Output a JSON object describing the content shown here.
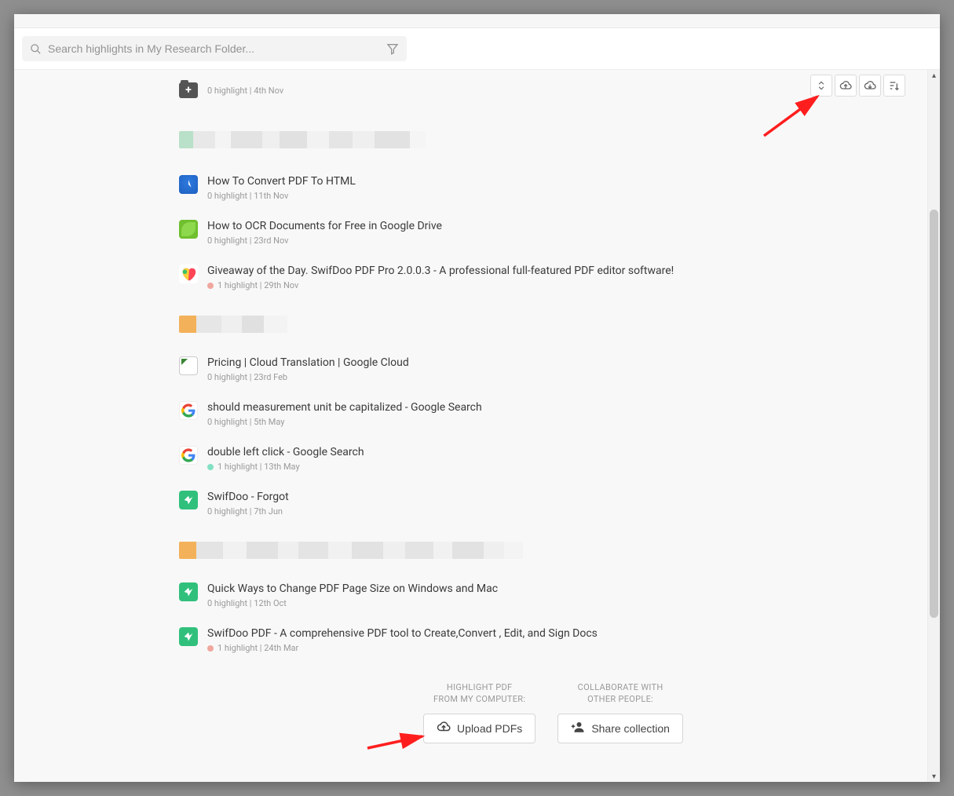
{
  "search": {
    "placeholder": "Search highlights in My Research Folder..."
  },
  "folder_row_meta": "0 highlight | 4th Nov",
  "items": [
    {
      "title": "How To Convert PDF To HTML",
      "meta": "0 highlight | 11th Nov",
      "fav": "blue-circle",
      "dot": null
    },
    {
      "title": "How to OCR Documents for Free in Google Drive",
      "meta": "0 highlight | 23rd Nov",
      "fav": "leaf",
      "dot": null
    },
    {
      "title": "Giveaway of the Day. SwifDoo PDF Pro 2.0.0.3 - A professional full-featured PDF editor software!",
      "meta": "1 highlight | 29th Nov",
      "fav": "heart",
      "dot": "#f0a79e"
    },
    {
      "title": "Pricing   |   Cloud Translation   |   Google Cloud",
      "meta": "0 highlight | 23rd Feb",
      "fav": "missing",
      "dot": null
    },
    {
      "title": "should measurement unit be capitalized - Google Search",
      "meta": "0 highlight | 5th May",
      "fav": "google",
      "dot": null
    },
    {
      "title": "double left click - Google Search",
      "meta": "1 highlight | 13th May",
      "fav": "google",
      "dot": "#83e0c3"
    },
    {
      "title": "SwifDoo - Forgot",
      "meta": "0 highlight | 7th Jun",
      "fav": "swifdoo",
      "dot": null
    },
    {
      "title": "Quick Ways to Change PDF Page Size on Windows and Mac",
      "meta": "0 highlight | 12th Oct",
      "fav": "swifdoo",
      "dot": null
    },
    {
      "title": "SwifDoo PDF - A comprehensive PDF tool to Create,Convert , Edit, and Sign Docs",
      "meta": "1 highlight | 24th Mar",
      "fav": "swifdoo",
      "dot": "#f0a79e"
    }
  ],
  "footer": {
    "upload_caption": "HIGHLIGHT PDF\nFROM MY COMPUTER:",
    "upload_label": "Upload PDFs",
    "share_caption": "COLLABORATE WITH\nOTHER PEOPLE:",
    "share_label": "Share collection"
  }
}
